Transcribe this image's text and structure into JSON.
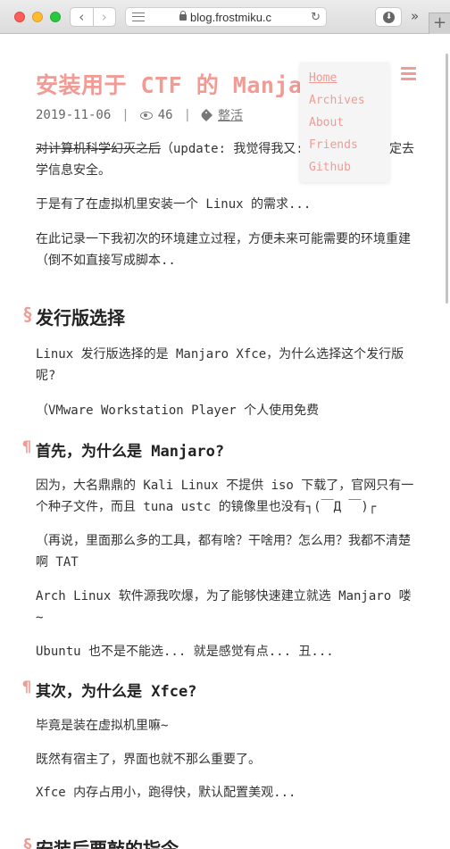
{
  "browser": {
    "url": "blog.frostmiku.c",
    "back_glyph": "‹",
    "forward_glyph": "›",
    "reload_glyph": "↻",
    "download_glyph": "⬇",
    "more_glyph": "»",
    "newtab_glyph": "+"
  },
  "post": {
    "title": "安装用于 CTF 的 Manja",
    "date": "2019-11-06",
    "meta_sep": "|",
    "views": "46",
    "tag": "整活"
  },
  "nav": {
    "items": [
      "Home",
      "Archives",
      "About",
      "Friends",
      "Github"
    ]
  },
  "content": {
    "intro": {
      "struck": "对计算机科学幻灭之后",
      "line1_rest": "（update: 我觉得我又:",
      "line1_end": "定去",
      "line2": "学信息安全。"
    },
    "p_need": "于是有了在虚拟机里安装一个 Linux 的需求...",
    "p_record": "在此记录一下我初次的环境建立过程，方便未来可能需要的环境重建（倒不如直接写成脚本..",
    "h2_distro": "发行版选择",
    "p_distro": "Linux 发行版选择的是 Manjaro Xfce，为什么选择这个发行版呢?",
    "p_vmware": "（VMware Workstation Player 个人使用免费",
    "h3_manjaro": "首先，为什么是 Manjaro?",
    "p_kali": "因为，大名鼎鼎的 Kali Linux 不提供 iso 下载了，官网只有一个种子文件，而且 tuna ustc 的镜像里也没有┐(￣Д ￣)┌",
    "p_tools": "（再说，里面那么多的工具，都有啥？干啥用？怎么用？我都不清楚啊 TAT",
    "p_arch": "Arch Linux 软件源我吹爆，为了能够快速建立就选 Manjaro 喽~",
    "p_ubuntu": "Ubuntu 也不是不能选... 就是感觉有点... 丑...",
    "h3_xfce": "其次，为什么是 Xfce?",
    "p_vm": "毕竟是装在虚拟机里嘛~",
    "p_host": "既然有宿主了，界面也就不那么重要了。",
    "p_xfce": "Xfce 内存占用小，跑得快，默认配置美观...",
    "h2_next": "安装后要敲的指令",
    "section_marker": "§",
    "sub_marker": "¶"
  },
  "colors": {
    "accent": "#f19b95",
    "text": "#333333",
    "menu_bg": "#f5f5f5"
  }
}
